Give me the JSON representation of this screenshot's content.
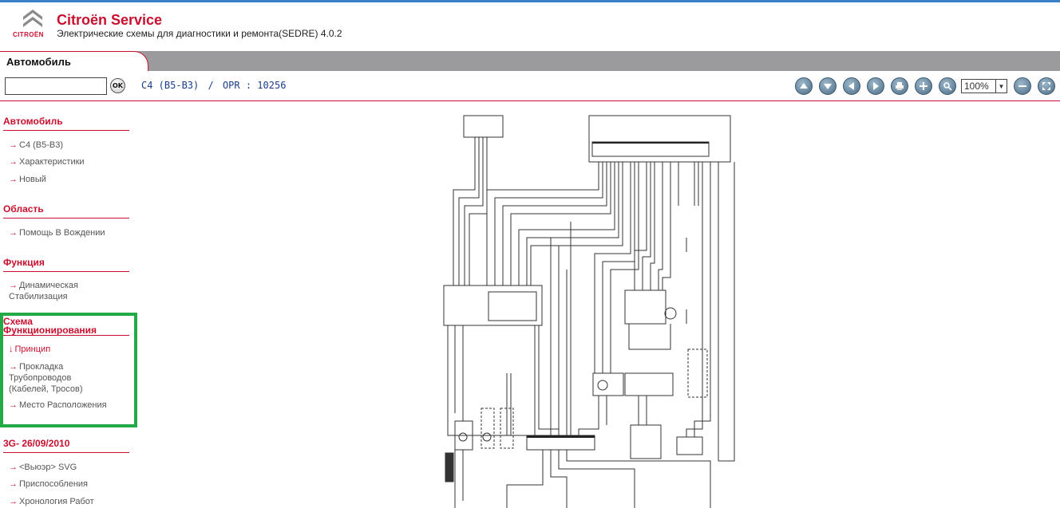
{
  "header": {
    "logo_text": "CITROËN",
    "title": "Citroën Service",
    "subtitle": "Электрические схемы для диагностики и ремонта(SEDRE) 4.0.2"
  },
  "tab": {
    "label": "Автомобиль"
  },
  "toolbar": {
    "search_value": "",
    "ok_label": "OK",
    "breadcrumb": [
      "C4 (B5-B3)",
      "/",
      "OPR : 10256"
    ],
    "zoom": "100%",
    "icons": [
      "arrow-up-icon",
      "arrow-down-icon",
      "arrow-left-icon",
      "arrow-right-icon",
      "print-icon",
      "zoom-in-icon",
      "magnifier-icon",
      "zoom-out-icon",
      "fit-window-icon"
    ]
  },
  "sidebar": {
    "sections": [
      {
        "title": "Автомобиль",
        "items": [
          "C4 (B5-B3)",
          "Характеристики",
          "Новый"
        ]
      },
      {
        "title": "Область",
        "items": [
          "Помощь В Вождении"
        ]
      },
      {
        "title": "Функция",
        "items": [
          "Динамическая Стабилизация"
        ]
      },
      {
        "title": "Схема Функционирования",
        "items": [
          "Принцип",
          "Прокладка Трубопроводов (Кабелей, Тросов)",
          "Место Расположения"
        ]
      },
      {
        "title": "3G- 26/09/2010",
        "items": [
          "<Вьюэр> SVG",
          "Приспособления",
          "Хронология Работ"
        ]
      }
    ],
    "active_item": "Принцип"
  },
  "colors": {
    "brand": "#c8102e",
    "tabbar": "#9b9a9d",
    "highlight": "#22aa44",
    "link": "#1a3c8c"
  }
}
